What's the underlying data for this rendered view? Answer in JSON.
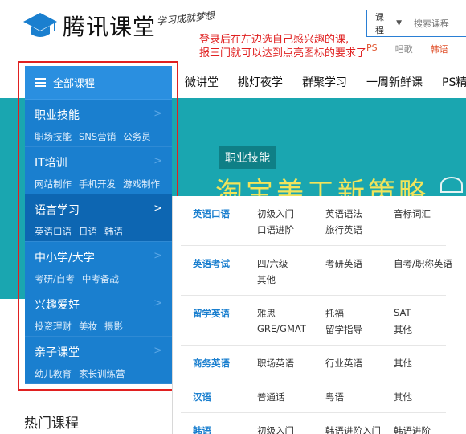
{
  "header": {
    "logo_text": "腾讯课堂",
    "slogan": "学习成就梦想",
    "search": {
      "category": "课程",
      "placeholder": "搜索课程"
    },
    "hot_tags": [
      {
        "label": "PS",
        "color": "#e0522c"
      },
      {
        "label": "唱歌",
        "color": "#888888"
      },
      {
        "label": "韩语",
        "color": "#e0522c"
      }
    ]
  },
  "annotation": {
    "line1": "登录后在左边选自己感兴趣的课,",
    "line2": "报三门就可以达到点亮图标的要求了"
  },
  "topnav": [
    "微讲堂",
    "挑灯夜学",
    "群聚学习",
    "一周新鲜课",
    "PS精选"
  ],
  "banner": {
    "badge": "职业技能",
    "title": "淘宝美工新策略"
  },
  "sidebar": {
    "header_label": "全部课程",
    "items": [
      {
        "title": "职业技能",
        "subs": [
          "职场技能",
          "SNS营销",
          "公务员"
        ],
        "active": false
      },
      {
        "title": "IT培训",
        "subs": [
          "网站制作",
          "手机开发",
          "游戏制作"
        ],
        "active": false
      },
      {
        "title": "语言学习",
        "subs": [
          "英语口语",
          "日语",
          "韩语"
        ],
        "active": true
      },
      {
        "title": "中小学/大学",
        "subs": [
          "考研/自考",
          "中考备战"
        ],
        "active": false
      },
      {
        "title": "兴趣爱好",
        "subs": [
          "投资理财",
          "美妆",
          "摄影"
        ],
        "active": false
      },
      {
        "title": "亲子课堂",
        "subs": [
          "幼儿教育",
          "家长训练营"
        ],
        "active": false
      }
    ],
    "arrow_glyph": ">"
  },
  "flyout": {
    "rows": [
      {
        "category": "英语口语",
        "links": [
          "初级入门",
          "英语语法",
          "音标词汇",
          "口语进阶",
          "旅行英语"
        ]
      },
      {
        "category": "英语考试",
        "links": [
          "四/六级",
          "考研英语",
          "自考/职称英语",
          "其他"
        ]
      },
      {
        "category": "留学英语",
        "links": [
          "雅思",
          "托福",
          "SAT",
          "GRE/GMAT",
          "留学指导",
          "其他"
        ]
      },
      {
        "category": "商务英语",
        "links": [
          "职场英语",
          "行业英语",
          "其他"
        ]
      },
      {
        "category": "汉语",
        "links": [
          "普通话",
          "粤语",
          "其他"
        ]
      },
      {
        "category": "韩语",
        "links": [
          "初级入门",
          "韩语进阶入门",
          "韩语进阶"
        ]
      }
    ]
  },
  "hot_title": "热门课程",
  "colors": {
    "brand_blue": "#1a7fcf",
    "banner_teal": "#1aa6b0",
    "annotation_red": "#e02020",
    "banner_title_yellow": "#f2e45a"
  }
}
